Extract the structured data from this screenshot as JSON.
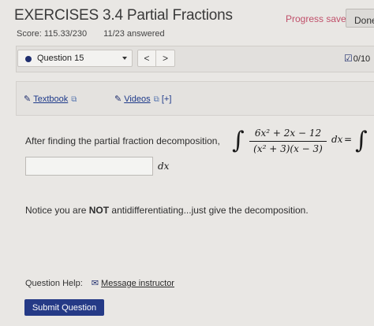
{
  "header": {
    "title": "EXERCISES 3.4 Partial Fractions",
    "progress_status": "Progress saved",
    "done_label": "Done",
    "score": "Score: 115.33/230",
    "answered": "11/23 answered"
  },
  "question_nav": {
    "selected_question": "Question 15",
    "prev_label": "<",
    "next_label": ">",
    "count": "0/10",
    "check_icon": "checkbox-icon"
  },
  "resources": {
    "textbook_label": "Textbook",
    "videos_label": "Videos",
    "videos_suffix": "[+]",
    "pencil_icon": "pencil-icon",
    "external_icon": "external-link-icon"
  },
  "problem": {
    "prompt": "After finding the partial fraction decomposition,",
    "integral_sign": "∫",
    "numerator": "6x² + 2x − 12",
    "denominator": "(x² + 3)(x − 3)",
    "dx": "dx",
    "equals": "=",
    "answer_value": "",
    "answer_dx": "dx",
    "notice_prefix": "Notice you are ",
    "notice_bold": "NOT",
    "notice_suffix": " antidifferentiating...just give the decomposition."
  },
  "footer": {
    "help_label": "Question Help:",
    "message_label": "Message instructor",
    "submit_label": "Submit Question"
  },
  "colors": {
    "accent": "#253a86",
    "progress": "#c0506a",
    "background": "#e9e7e4"
  }
}
